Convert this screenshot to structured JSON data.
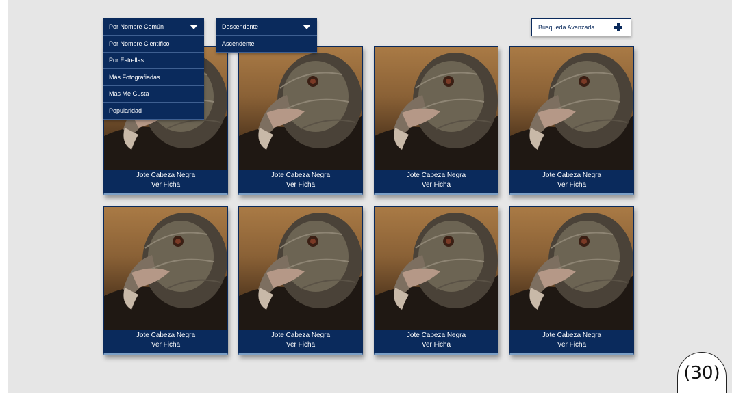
{
  "sort_by": {
    "selected": "Por Nombre Común",
    "options": [
      "Por Nombre Científico",
      "Por Estrellas",
      "Más Fotografiadas",
      "Más Me Gusta",
      "Popularidad"
    ]
  },
  "order": {
    "selected": "Descendente",
    "options": [
      "Ascendente"
    ]
  },
  "advanced_search": {
    "label": "Búsqueda Avanzada"
  },
  "cards": [
    {
      "name": "Jote Cabeza Negra",
      "link": "Ver Ficha"
    },
    {
      "name": "Jote Cabeza Negra",
      "link": "Ver Ficha"
    },
    {
      "name": "Jote Cabeza Negra",
      "link": "Ver Ficha"
    },
    {
      "name": "Jote Cabeza Negra",
      "link": "Ver Ficha"
    },
    {
      "name": "Jote Cabeza Negra",
      "link": "Ver Ficha"
    },
    {
      "name": "Jote Cabeza Negra",
      "link": "Ver Ficha"
    },
    {
      "name": "Jote Cabeza Negra",
      "link": "Ver Ficha"
    },
    {
      "name": "Jote Cabeza Negra",
      "link": "Ver Ficha"
    }
  ],
  "page_badge": "(30)",
  "colors": {
    "primary": "#0a2a5c",
    "accent": "#7b9fc6",
    "background": "#e6e6e6"
  }
}
